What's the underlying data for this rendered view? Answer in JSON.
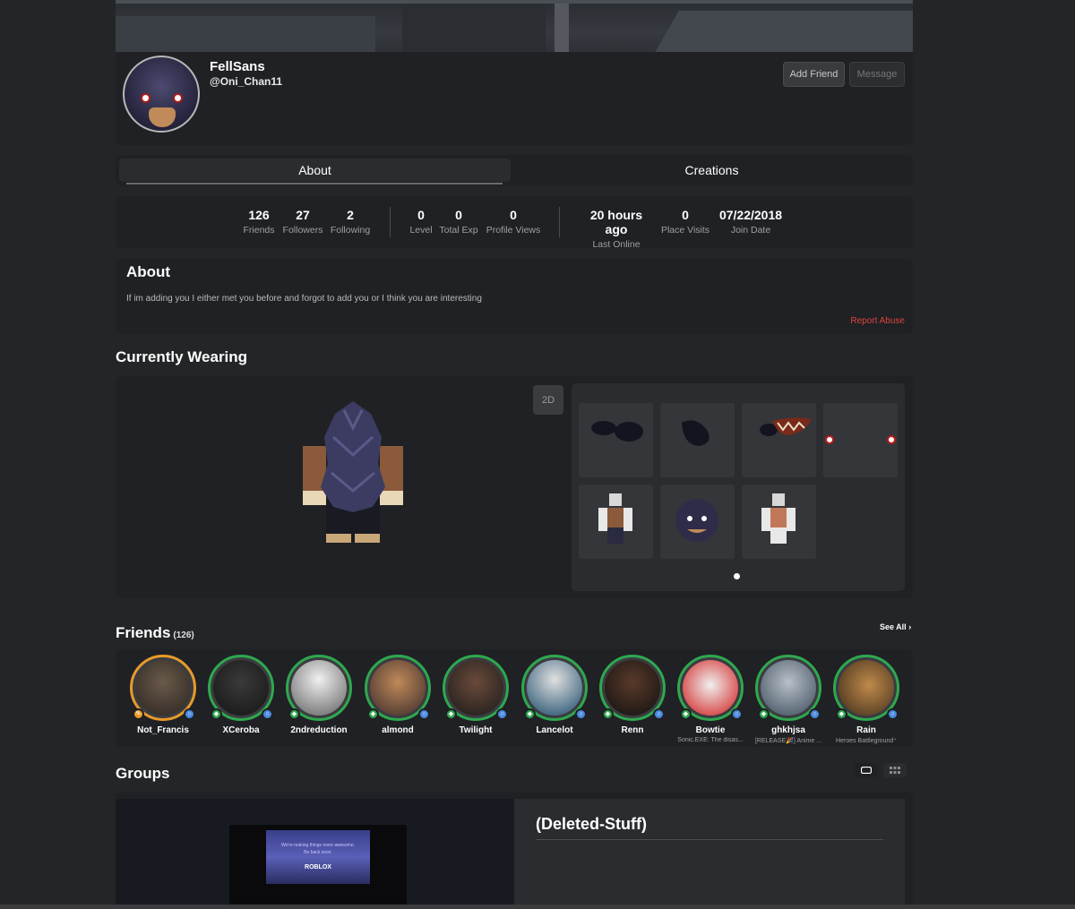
{
  "profile": {
    "display_name": "FellSans",
    "username": "@Oni_Chan11",
    "add_friend_label": "Add Friend",
    "message_label": "Message"
  },
  "tabs": [
    {
      "label": "About",
      "active": true
    },
    {
      "label": "Creations",
      "active": false
    }
  ],
  "stats": [
    {
      "value": "126",
      "label": "Friends"
    },
    {
      "value": "27",
      "label": "Followers"
    },
    {
      "value": "2",
      "label": "Following"
    },
    {
      "value": "0",
      "label": "Level"
    },
    {
      "value": "0",
      "label": "Total Exp"
    },
    {
      "value": "0",
      "label": "Profile Views"
    },
    {
      "value": "20 hours ago",
      "label": "Last Online"
    },
    {
      "value": "0",
      "label": "Place Visits"
    },
    {
      "value": "07/22/2018",
      "label": "Join Date"
    }
  ],
  "about": {
    "title": "About",
    "text": "If im adding you I either met you before and forgot to add you or I think you are interesting",
    "report_label": "Report Abuse"
  },
  "wearing": {
    "title": "Currently Wearing",
    "toggle_label": "2D"
  },
  "friends": {
    "title": "Friends",
    "count": "(126)",
    "see_all": "See All",
    "list": [
      {
        "name": "Not_Francis",
        "sub": "",
        "ring": "orange"
      },
      {
        "name": "XCeroba",
        "sub": "",
        "ring": "green"
      },
      {
        "name": "2ndreduction",
        "sub": "",
        "ring": "green"
      },
      {
        "name": "almond",
        "sub": "",
        "ring": "green"
      },
      {
        "name": "Twilight",
        "sub": "",
        "ring": "green"
      },
      {
        "name": "Lancelot",
        "sub": "",
        "ring": "green"
      },
      {
        "name": "Renn",
        "sub": "",
        "ring": "green"
      },
      {
        "name": "Bowtie",
        "sub": "Sonic.EXE: The disas...",
        "ring": "green"
      },
      {
        "name": "ghkhjsa",
        "sub": "[RELEASE🎉] Anime ...",
        "ring": "green"
      },
      {
        "name": "Rain",
        "sub": "Heroes Battleground⁺",
        "ring": "green"
      }
    ]
  },
  "groups": {
    "title": "Groups",
    "group_name": "(Deleted-Stuff)",
    "thumb_text_1": "We're making things more awesome.",
    "thumb_text_2": "Be back soon.",
    "thumb_logo": "ROBLOX"
  },
  "colors": {
    "background": "#232527",
    "card": "#1f2124",
    "online_green": "#2fa84f",
    "report_red": "#e0433f"
  }
}
